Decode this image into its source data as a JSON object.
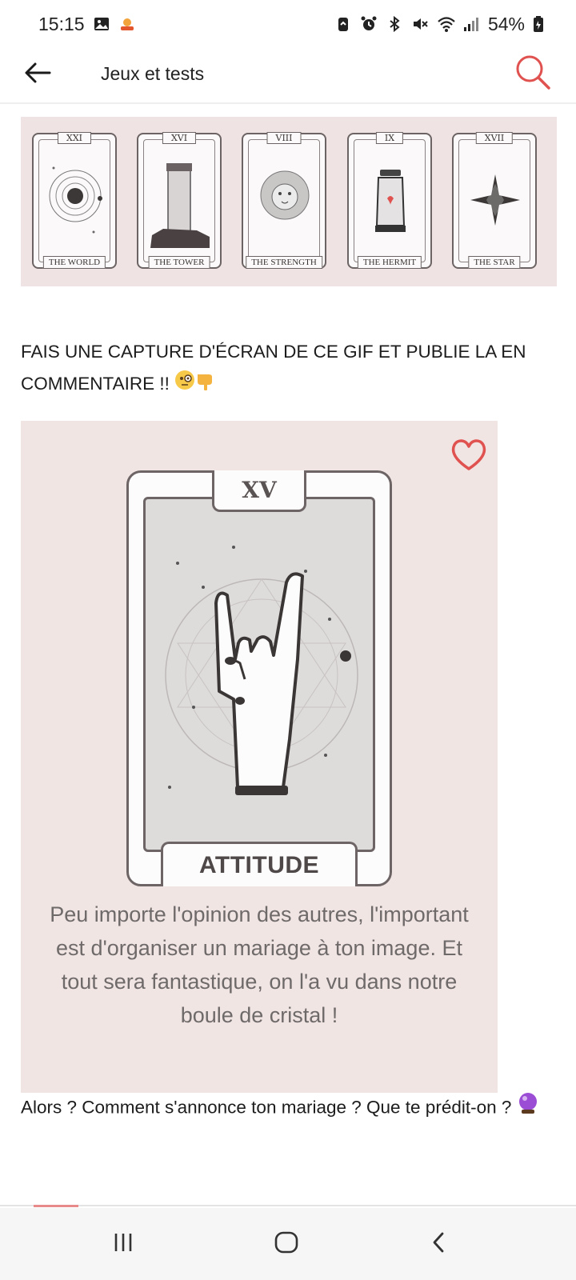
{
  "status_bar": {
    "time": "15:15",
    "battery": "54%",
    "left_icons": [
      "gallery-icon",
      "notification-icon"
    ],
    "right_icons": [
      "battery-saver-icon",
      "alarm-icon",
      "bluetooth-icon",
      "mute-icon",
      "wifi-icon",
      "signal-icon",
      "battery-icon"
    ]
  },
  "app_bar": {
    "title": "Jeux et tests",
    "back_icon": "arrow-left-icon",
    "search_icon": "search-icon",
    "accent_color": "#e0524f"
  },
  "banner": {
    "cards": [
      {
        "numeral": "XXI",
        "name": "THE WORLD",
        "icon": "planet-icon"
      },
      {
        "numeral": "XVI",
        "name": "THE TOWER",
        "icon": "tower-icon"
      },
      {
        "numeral": "VIII",
        "name": "THE STRENGTH",
        "icon": "lion-icon"
      },
      {
        "numeral": "IX",
        "name": "THE HERMIT",
        "icon": "lantern-icon"
      },
      {
        "numeral": "XVII",
        "name": "THE STAR",
        "icon": "star-icon"
      }
    ]
  },
  "post": {
    "caption": "FAIS UNE CAPTURE D'ÉCRAN DE CE GIF ET PUBLIE LA EN COMMENTAIRE !!",
    "caption_emojis": [
      "monocle-face-emoji",
      "pointing-down-emoji"
    ],
    "question": "Alors ? Comment s'annonce ton mariage ? Que te prédit-on ?",
    "question_emoji": "crystal-ball-emoji"
  },
  "tarot_card": {
    "numeral": "XV",
    "title": "ATTITUDE",
    "quote": "Peu importe l'opinion des autres, l'important est d'organiser un mariage à ton image. Et tout sera fantastique, on l'a vu dans notre boule de cristal !",
    "heart_icon": "heart-icon",
    "illustration_icon": "rock-hand-icon"
  },
  "nav_bar": {
    "buttons": [
      "recent-apps-icon",
      "home-icon",
      "back-icon"
    ]
  }
}
